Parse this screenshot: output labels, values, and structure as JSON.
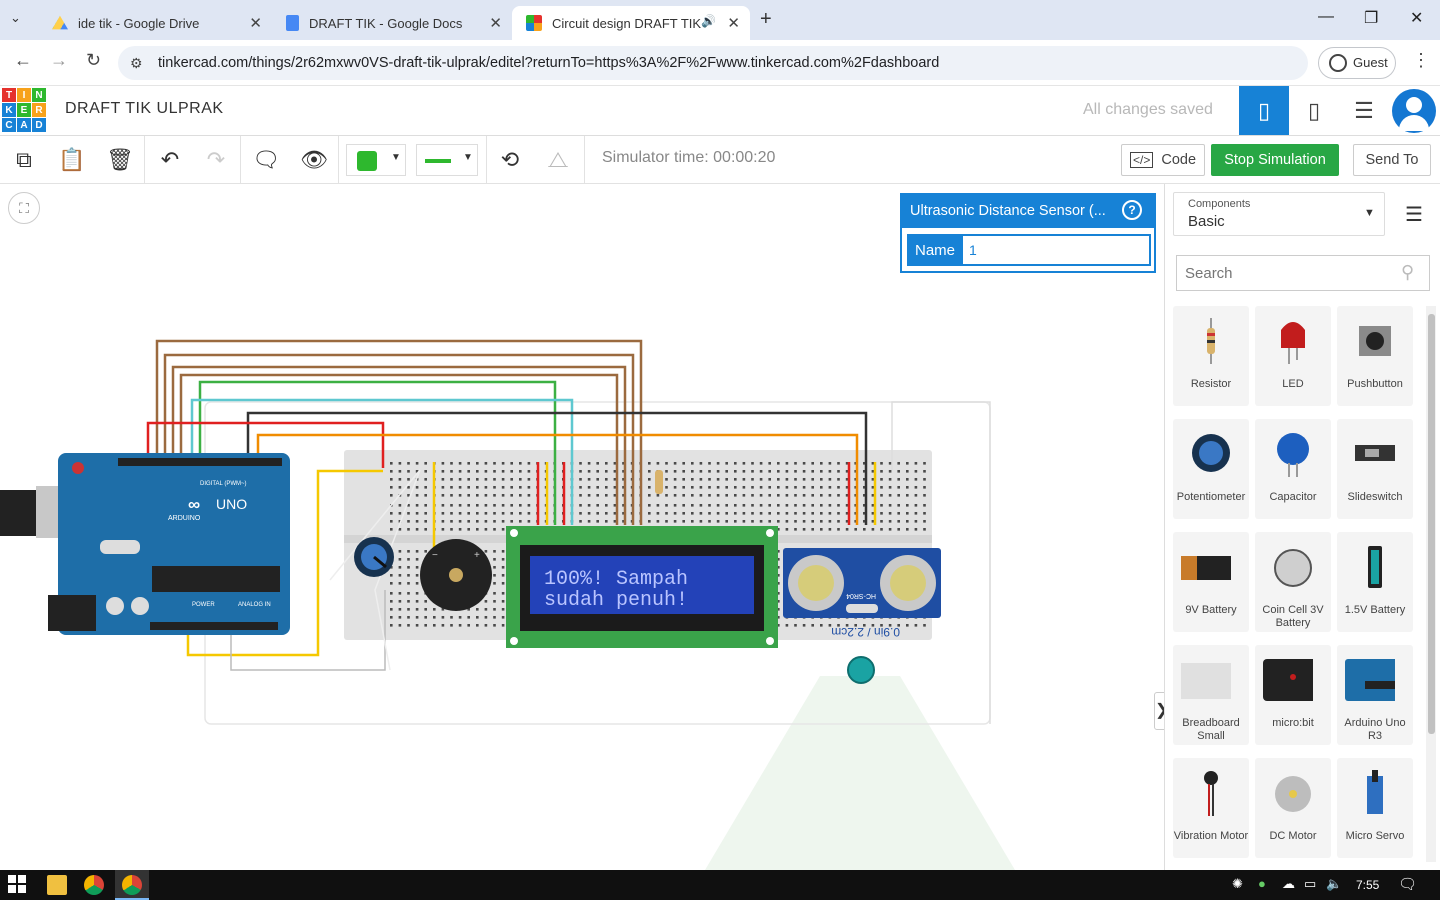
{
  "browser": {
    "tabs": [
      {
        "title": "ide tik - Google Drive",
        "active": false,
        "icon": "google-drive-icon"
      },
      {
        "title": "DRAFT TIK - Google Docs",
        "active": false,
        "icon": "google-docs-icon"
      },
      {
        "title": "Circuit design DRAFT TIK UL",
        "active": true,
        "icon": "tinkercad-icon"
      }
    ],
    "url": "tinkercad.com/things/2r62mxwv0VS-draft-tik-ulprak/editel?returnTo=https%3A%2F%2Fwww.tinkercad.com%2Fdashboard",
    "profile_label": "Guest"
  },
  "app": {
    "logo_letters": [
      "T",
      "I",
      "N",
      "K",
      "E",
      "R",
      "C",
      "A",
      "D"
    ],
    "project_title": "DRAFT TIK ULPRAK",
    "save_status": "All changes saved"
  },
  "toolbar": {
    "simulator_time": "Simulator time: 00:00:20",
    "code_label": "Code",
    "stop_label": "Stop Simulation",
    "send_label": "Send To",
    "fill_color": "#2eb82e",
    "wire_color": "#2eb82e"
  },
  "inspector": {
    "title": "Ultrasonic Distance Sensor (...",
    "name_label": "Name",
    "name_value": "1"
  },
  "canvas": {
    "arduino_brand": "ARDUINO",
    "arduino_model": "UNO",
    "arduino_digital_label": "DIGITAL (PWM~)",
    "arduino_power_label": "POWER",
    "arduino_analog_label": "ANALOG IN",
    "lcd_line1": "100%! Sampah",
    "lcd_line2": "sudah penuh!",
    "sensor_model": "HC-SR04",
    "sensor_readout": "0.9in / 2.2cm"
  },
  "components": {
    "dropdown_label": "Components",
    "dropdown_value": "Basic",
    "search_placeholder": "Search",
    "items": [
      {
        "label": "Resistor"
      },
      {
        "label": "LED"
      },
      {
        "label": "Pushbutton"
      },
      {
        "label": "Potentiometer"
      },
      {
        "label": "Capacitor"
      },
      {
        "label": "Slideswitch"
      },
      {
        "label": "9V Battery"
      },
      {
        "label": "Coin Cell 3V Battery"
      },
      {
        "label": "1.5V Battery"
      },
      {
        "label": "Breadboard Small"
      },
      {
        "label": "micro:bit"
      },
      {
        "label": "Arduino Uno R3"
      },
      {
        "label": "Vibration Motor"
      },
      {
        "label": "DC Motor"
      },
      {
        "label": "Micro Servo"
      }
    ]
  },
  "taskbar": {
    "time": "7:55"
  },
  "colors": {
    "accent": "#1782d6",
    "stop_button": "#28a745"
  }
}
